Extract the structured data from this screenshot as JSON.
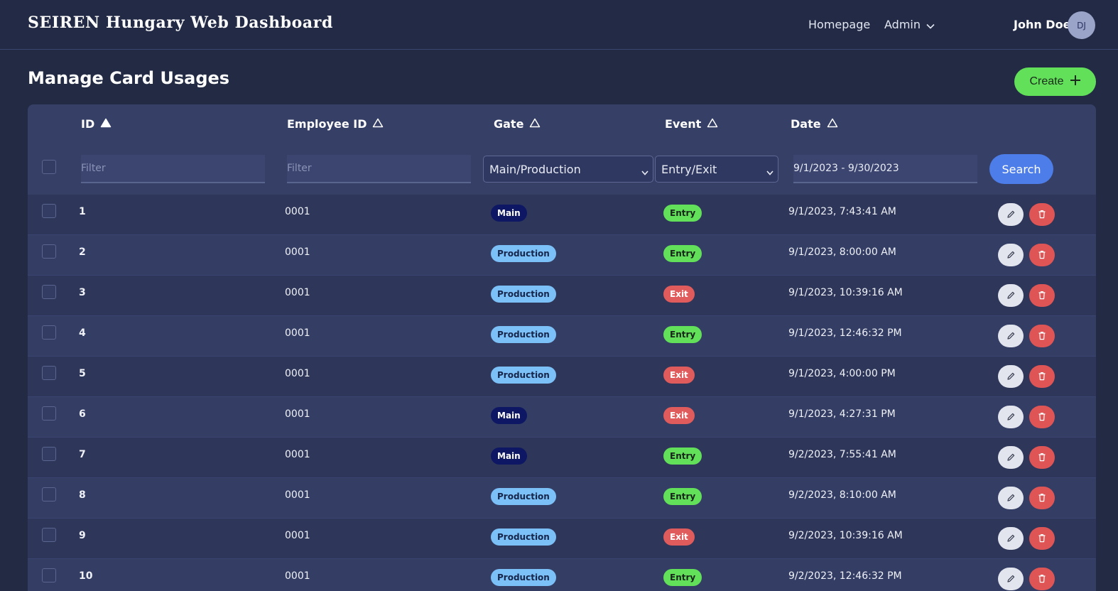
{
  "header": {
    "title": "SEIREN Hungary Web Dashboard",
    "nav": {
      "home": "Homepage",
      "admin": "Admin"
    },
    "user": {
      "name": "John Doe",
      "initials": "DJ"
    }
  },
  "page": {
    "title": "Manage Card Usages",
    "create_label": "Create"
  },
  "table": {
    "columns": {
      "id": "ID",
      "employee_id": "Employee ID",
      "gate": "Gate",
      "event": "Event",
      "date": "Date"
    },
    "filters": {
      "id_placeholder": "Filter",
      "employee_placeholder": "Filter",
      "gate_value": "Main/Production",
      "event_value": "Entry/Exit",
      "date_range": "9/1/2023 - 9/30/2023",
      "search_label": "Search"
    },
    "rows": [
      {
        "id": "1",
        "employee_id": "0001",
        "gate": "Main",
        "event": "Entry",
        "date": "9/1/2023, 7:43:41 AM"
      },
      {
        "id": "2",
        "employee_id": "0001",
        "gate": "Production",
        "event": "Entry",
        "date": "9/1/2023, 8:00:00 AM"
      },
      {
        "id": "3",
        "employee_id": "0001",
        "gate": "Production",
        "event": "Exit",
        "date": "9/1/2023, 10:39:16 AM"
      },
      {
        "id": "4",
        "employee_id": "0001",
        "gate": "Production",
        "event": "Entry",
        "date": "9/1/2023, 12:46:32 PM"
      },
      {
        "id": "5",
        "employee_id": "0001",
        "gate": "Production",
        "event": "Exit",
        "date": "9/1/2023, 4:00:00 PM"
      },
      {
        "id": "6",
        "employee_id": "0001",
        "gate": "Main",
        "event": "Exit",
        "date": "9/1/2023, 4:27:31 PM"
      },
      {
        "id": "7",
        "employee_id": "0001",
        "gate": "Main",
        "event": "Entry",
        "date": "9/2/2023, 7:55:41 AM"
      },
      {
        "id": "8",
        "employee_id": "0001",
        "gate": "Production",
        "event": "Entry",
        "date": "9/2/2023, 8:10:00 AM"
      },
      {
        "id": "9",
        "employee_id": "0001",
        "gate": "Production",
        "event": "Exit",
        "date": "9/2/2023, 10:39:16 AM"
      },
      {
        "id": "10",
        "employee_id": "0001",
        "gate": "Production",
        "event": "Entry",
        "date": "9/2/2023, 12:46:32 PM"
      }
    ]
  },
  "colors": {
    "background": "#232a44",
    "create": "#62e05a",
    "search": "#4d7de8",
    "entry": "#62e05a",
    "exit": "#e05b5b",
    "main_gate": "#0d1763",
    "production_gate": "#7cc0f8"
  }
}
